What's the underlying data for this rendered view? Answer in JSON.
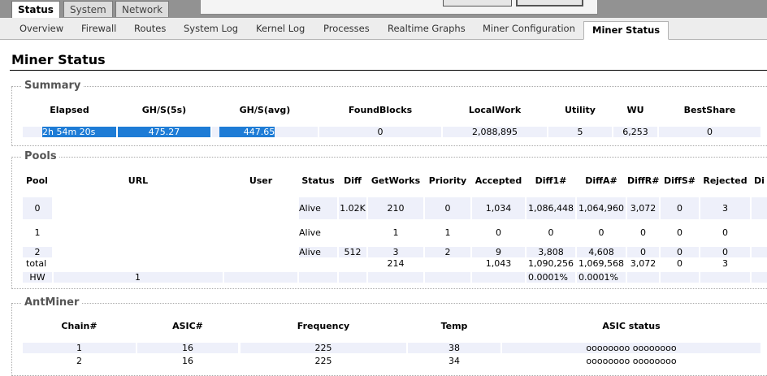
{
  "main_tabs": [
    "Status",
    "System",
    "Network"
  ],
  "sub_tabs": [
    "Overview",
    "Firewall",
    "Routes",
    "System Log",
    "Kernel Log",
    "Processes",
    "Realtime Graphs",
    "Miner Configuration",
    "Miner Status"
  ],
  "page_title": "Miner Status",
  "summary": {
    "legend": "Summary",
    "headers": [
      "Elapsed",
      "GH/S(5s)",
      "GH/S(avg)",
      "FoundBlocks",
      "LocalWork",
      "Utility",
      "WU",
      "BestShare"
    ],
    "row": [
      "2h 54m 20s",
      "475.27",
      "447.65",
      "0",
      "2,088,895",
      "5",
      "6,253",
      "0"
    ]
  },
  "pools": {
    "legend": "Pools",
    "headers": [
      "Pool",
      "URL",
      "User",
      "Status",
      "Diff",
      "GetWorks",
      "Priority",
      "Accepted",
      "Diff1#",
      "DiffA#",
      "DiffR#",
      "DiffS#",
      "Rejected",
      "Di"
    ],
    "rows": [
      [
        "0",
        "",
        "",
        "Alive",
        "1.02K",
        "210",
        "0",
        "1,034",
        "1,086,448",
        "1,064,960",
        "3,072",
        "0",
        "3",
        ""
      ],
      [
        "1",
        "",
        "",
        "Alive",
        "",
        "1",
        "1",
        "0",
        "0",
        "0",
        "0",
        "0",
        "0",
        ""
      ],
      [
        "2",
        "",
        "",
        "Alive",
        "512",
        "3",
        "2",
        "9",
        "3,808",
        "4,608",
        "0",
        "0",
        "0",
        ""
      ],
      [
        "total",
        "",
        "",
        "",
        "",
        "214",
        "",
        "1,043",
        "1,090,256",
        "1,069,568",
        "3,072",
        "0",
        "3",
        ""
      ]
    ],
    "hw_row": {
      "label": "HW",
      "value": "1",
      "diff1_pct": "0.0001%",
      "diffa_pct": "0.0001%"
    }
  },
  "antminer": {
    "legend": "AntMiner",
    "headers": [
      "Chain#",
      "ASIC#",
      "Frequency",
      "Temp",
      "ASIC status"
    ],
    "rows": [
      [
        "1",
        "16",
        "225",
        "38",
        "oooooooo oooooooo"
      ],
      [
        "2",
        "16",
        "225",
        "34",
        "oooooooo oooooooo"
      ]
    ]
  },
  "colors": {
    "selection": "#1e7cd6",
    "row_bg": "#eef0fa",
    "header_band": "#929292"
  }
}
